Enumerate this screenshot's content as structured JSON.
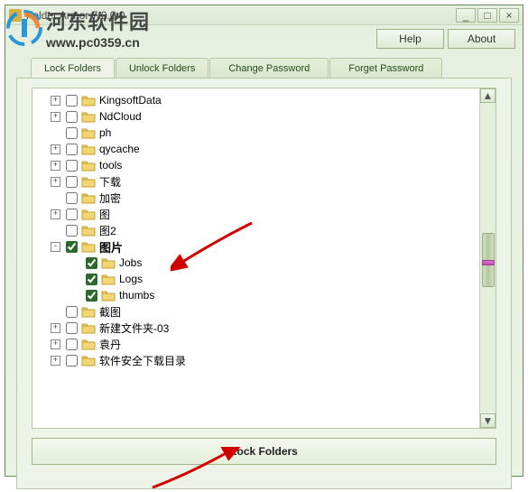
{
  "window_title": "Folder Armor 7.0.0.0",
  "toolbar": {
    "help": "Help",
    "about": "About"
  },
  "tabs": {
    "lock": "Lock Folders",
    "unlock": "Unlock Folders",
    "change": "Change Password",
    "forget": "Forget Password"
  },
  "tree": [
    {
      "depth": 1,
      "expand": "+",
      "checked": false,
      "label": "KingsoftData",
      "bold": false
    },
    {
      "depth": 1,
      "expand": "+",
      "checked": false,
      "label": "NdCloud",
      "bold": false
    },
    {
      "depth": 1,
      "expand": "",
      "checked": false,
      "label": "ph",
      "bold": false
    },
    {
      "depth": 1,
      "expand": "+",
      "checked": false,
      "label": "qycache",
      "bold": false
    },
    {
      "depth": 1,
      "expand": "+",
      "checked": false,
      "label": "tools",
      "bold": false
    },
    {
      "depth": 1,
      "expand": "+",
      "checked": false,
      "label": "下载",
      "bold": false
    },
    {
      "depth": 1,
      "expand": "",
      "checked": false,
      "label": "加密",
      "bold": false
    },
    {
      "depth": 1,
      "expand": "+",
      "checked": false,
      "label": "图",
      "bold": false
    },
    {
      "depth": 1,
      "expand": "",
      "checked": false,
      "label": "图2",
      "bold": false
    },
    {
      "depth": 1,
      "expand": "-",
      "checked": true,
      "label": "图片",
      "bold": true
    },
    {
      "depth": 2,
      "expand": "",
      "checked": true,
      "label": "Jobs",
      "bold": false
    },
    {
      "depth": 2,
      "expand": "",
      "checked": true,
      "label": "Logs",
      "bold": false
    },
    {
      "depth": 2,
      "expand": "",
      "checked": true,
      "label": "thumbs",
      "bold": false
    },
    {
      "depth": 1,
      "expand": "",
      "checked": false,
      "label": "截图",
      "bold": false
    },
    {
      "depth": 1,
      "expand": "+",
      "checked": false,
      "label": "新建文件夹-03",
      "bold": false
    },
    {
      "depth": 1,
      "expand": "+",
      "checked": false,
      "label": "袁丹",
      "bold": false
    },
    {
      "depth": 1,
      "expand": "+",
      "checked": false,
      "label": "软件安全下载目录",
      "bold": false
    }
  ],
  "lock_button": "Lock Folders",
  "watermark": {
    "text": "河东软件园",
    "url": "www.pc0359.cn"
  },
  "icons": {
    "minimize": "_",
    "maximize": "□",
    "close": "×",
    "scroll_up": "▲",
    "scroll_down": "▼"
  }
}
